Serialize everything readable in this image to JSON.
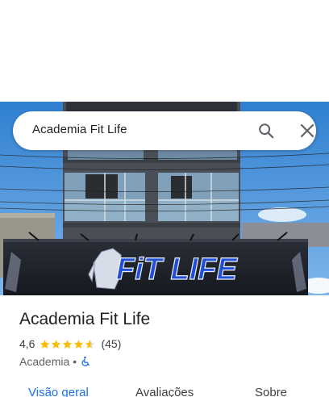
{
  "search": {
    "query": "Academia Fit Life"
  },
  "hero": {
    "sign_text": "FiT LIFE"
  },
  "place": {
    "name": "Academia Fit Life",
    "rating": "4,6",
    "rating_value": 4.6,
    "reviews": "(45)",
    "category": "Academia",
    "separator": "•"
  },
  "tabs": [
    {
      "label": "Visão geral",
      "active": true
    },
    {
      "label": "Avaliações",
      "active": false
    },
    {
      "label": "Sobre",
      "active": false
    }
  ],
  "colors": {
    "accent": "#1a73e8",
    "star": "#fbbc04",
    "sky": "#3f8ed8"
  }
}
